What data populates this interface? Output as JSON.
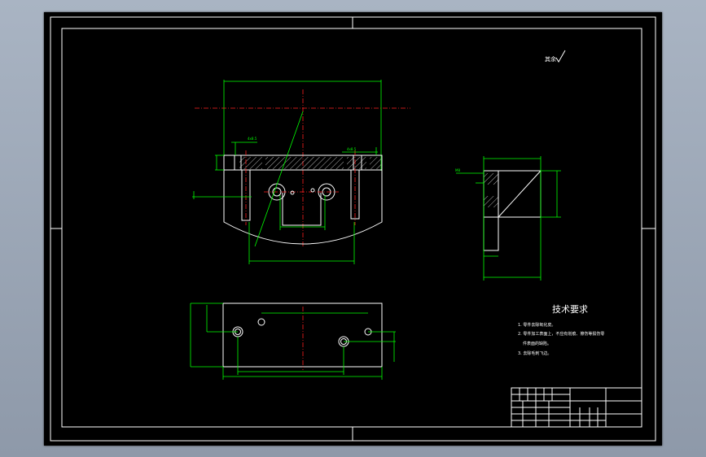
{
  "drawing": {
    "roughness_symbol": "其余",
    "tech_title": "技术要求",
    "tech_notes": [
      "1. 零件去除氧化皮。",
      "2. 零件加工表面上，不应有划痕、擦伤等损伤零",
      "件表面的缺陷。",
      "3. 去除毛刺飞边。"
    ]
  },
  "colors": {
    "background": "#000000",
    "outline": "#ffffff",
    "dimension": "#00ff00",
    "centerline": "#ff2020"
  }
}
